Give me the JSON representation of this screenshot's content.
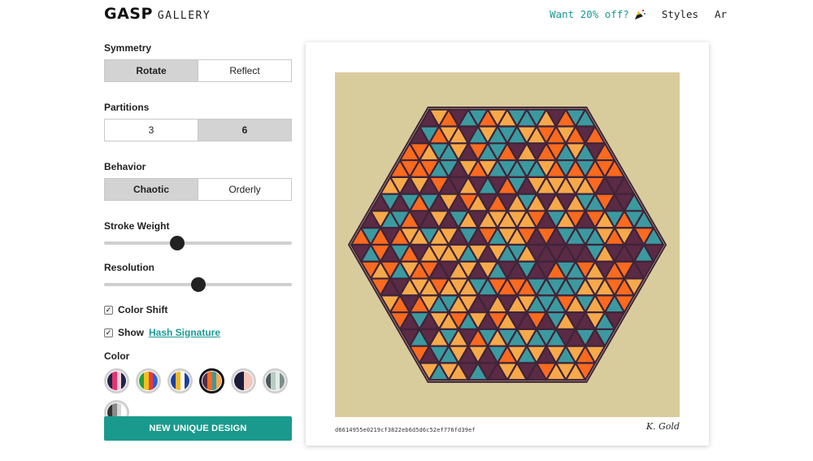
{
  "brand": {
    "main": "GASP",
    "sub": "GALLERY"
  },
  "nav": {
    "promo": "Want 20% off?",
    "promo_icon": "party-popper-icon",
    "styles": "Styles",
    "cut_link": "Ar"
  },
  "controls": {
    "symmetry": {
      "label": "Symmetry",
      "options": [
        "Rotate",
        "Reflect"
      ],
      "selected": "Rotate"
    },
    "partitions": {
      "label": "Partitions",
      "options": [
        "3",
        "6"
      ],
      "selected": "6"
    },
    "behavior": {
      "label": "Behavior",
      "options": [
        "Chaotic",
        "Orderly"
      ],
      "selected": "Chaotic"
    },
    "stroke_weight": {
      "label": "Stroke Weight",
      "value_fraction": 0.39
    },
    "resolution": {
      "label": "Resolution",
      "value_fraction": 0.5
    },
    "color_shift": {
      "label": "Color Shift",
      "checked": true
    },
    "hash_signature": {
      "prefix": "Show",
      "link": "Hash Signature",
      "checked": true
    },
    "color": {
      "label": "Color",
      "selected_index": 3,
      "palettes": [
        [
          "#1d2548",
          "#e8326e",
          "#f5d0dd",
          "#1d2548"
        ],
        [
          "#2a9d3c",
          "#f2c21b",
          "#e83a3a",
          "#2b5fd9"
        ],
        [
          "#1e3f9c",
          "#f2b822",
          "#ffffff",
          "#1e3f9c"
        ],
        [
          "#5b2a45",
          "#fa6a1f",
          "#3b9aa0",
          "#f7a94a"
        ],
        [
          "#1d1b3a",
          "#1d1b3a",
          "#f2c6bc",
          "#f2c6bc"
        ],
        [
          "#4a5a5a",
          "#b9ccc4",
          "#e2ece6",
          "#7d8f8a"
        ],
        [
          "#333333",
          "#8a8a8a",
          "#d6d6d6",
          "#ffffff"
        ]
      ]
    }
  },
  "cta": {
    "label": "NEW UNIQUE DESIGN"
  },
  "artwork": {
    "background": "#d9cc9c",
    "stroke": "#3f2438",
    "colors": [
      "#5b2a45",
      "#fa6a1f",
      "#3b9aa0",
      "#f7a94a"
    ],
    "hash": "d6614955e0219cf3822eb6d5d6c52ef776fd39ef",
    "signature": "K. Gold"
  }
}
